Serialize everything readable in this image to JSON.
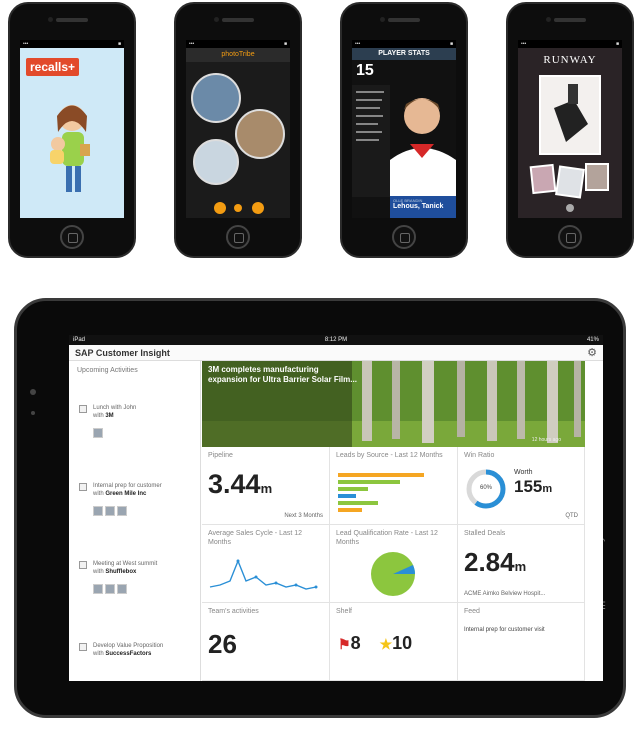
{
  "phones": [
    {
      "app": "recalls",
      "plus": "+"
    },
    {
      "app": "photoTribe"
    },
    {
      "header": "PLAYER STATS",
      "number": "15",
      "player_name": "Lehous, Tanick",
      "player_caption": "OLLE BRANDIN"
    },
    {
      "brand": "RUNWAY"
    }
  ],
  "tablet": {
    "status_left": "iPad",
    "status_time": "8:12 PM",
    "status_right": "41%",
    "app_title": "SAP Customer Insight",
    "sidebar": {
      "section": "Upcoming Activities",
      "items": [
        {
          "title": "Lunch with John",
          "with_label": "with",
          "company": "3M"
        },
        {
          "title": "Internal prep for customer",
          "with_label": "with",
          "company": "Green Mile Inc"
        },
        {
          "title": "Meeting at West summit",
          "with_label": "with",
          "company": "Shufflebox"
        },
        {
          "title": "Develop Value Proposition",
          "with_label": "with",
          "company": "SuccessFactors"
        }
      ]
    },
    "news": {
      "headline": "3M completes manufacturing expansion for Ultra Barrier Solar Film...",
      "source": "12 hours ago"
    },
    "tiles": {
      "pipeline": {
        "title": "Pipeline",
        "value": "3.44",
        "unit": "m",
        "period": "Next 3 Months"
      },
      "leads": {
        "title": "Leads by Source - Last 12 Months"
      },
      "win_ratio": {
        "title": "Win Ratio",
        "percent": "60%",
        "worth_label": "Worth",
        "worth_value": "155",
        "worth_unit": "m",
        "period": "QTD"
      },
      "sales_cycle": {
        "title": "Average Sales Cycle - Last 12 Months"
      },
      "lead_qual": {
        "title": "Lead Qualification Rate - Last 12 Months"
      },
      "stalled": {
        "title": "Stalled Deals",
        "value": "2.84",
        "unit": "m",
        "account": "ACME Aimko Belview Hospit..."
      },
      "team": {
        "title": "Team's activities",
        "value": "26"
      },
      "shelf": {
        "title": "Shelf",
        "flag_count": "8",
        "star_count": "10"
      },
      "feed": {
        "title": "Feed",
        "item": "Internal prep for customer visit"
      }
    },
    "colors": {
      "accent": "#2a8fd6",
      "pie": "#8cc63e",
      "bars": [
        "#f5a623",
        "#8cc63e",
        "#2a8fd6"
      ]
    }
  }
}
